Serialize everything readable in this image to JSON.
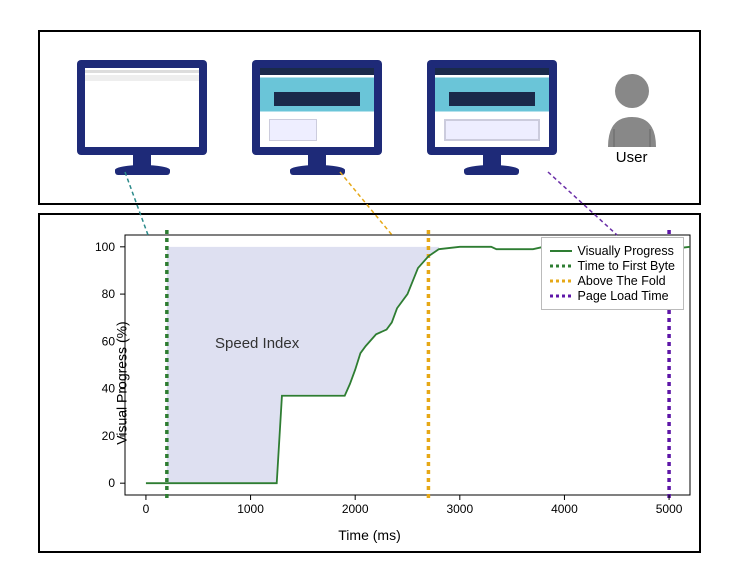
{
  "top": {
    "user_label": "User",
    "monitors": [
      {
        "state": "blank"
      },
      {
        "state": "partial"
      },
      {
        "state": "full"
      }
    ]
  },
  "chart_data": {
    "type": "line",
    "xlabel": "Time (ms)",
    "ylabel": "Visual Progress (%)",
    "xlim": [
      -200,
      5200
    ],
    "ylim": [
      -5,
      105
    ],
    "xticks": [
      0,
      1000,
      2000,
      3000,
      4000,
      5000
    ],
    "yticks": [
      0,
      20,
      40,
      60,
      80,
      100
    ],
    "annotation": "Speed Index",
    "series": [
      {
        "name": "Visually Progress",
        "color": "#2e7d32",
        "style": "solid",
        "x": [
          0,
          200,
          1250,
          1300,
          1900,
          1950,
          2000,
          2050,
          2100,
          2200,
          2300,
          2350,
          2400,
          2500,
          2600,
          2700,
          2800,
          3000,
          3300,
          3350,
          3700,
          3800,
          4400,
          4450,
          5000,
          5200
        ],
        "y": [
          0,
          0,
          0,
          37,
          37,
          42,
          48,
          55,
          58,
          63,
          65,
          68,
          74,
          80,
          91,
          96,
          99,
          100,
          100,
          99,
          99,
          100,
          100,
          99,
          99,
          100
        ]
      }
    ],
    "vlines": [
      {
        "name": "Time to First Byte",
        "x": 200,
        "color": "#2e7d32",
        "style": "dotted"
      },
      {
        "name": "Above The Fold",
        "x": 2700,
        "color": "#e6a817",
        "style": "dotted"
      },
      {
        "name": "Page Load Time",
        "x": 5000,
        "color": "#5e17a8",
        "style": "dotted"
      }
    ],
    "fill_region": {
      "x0": 200,
      "x1": 2800,
      "y1": 100,
      "color": "#c8cce8"
    }
  },
  "legend": {
    "items": [
      {
        "label": "Visually Progress"
      },
      {
        "label": "Time to First Byte"
      },
      {
        "label": "Above The Fold"
      },
      {
        "label": "Page Load Time"
      }
    ]
  }
}
